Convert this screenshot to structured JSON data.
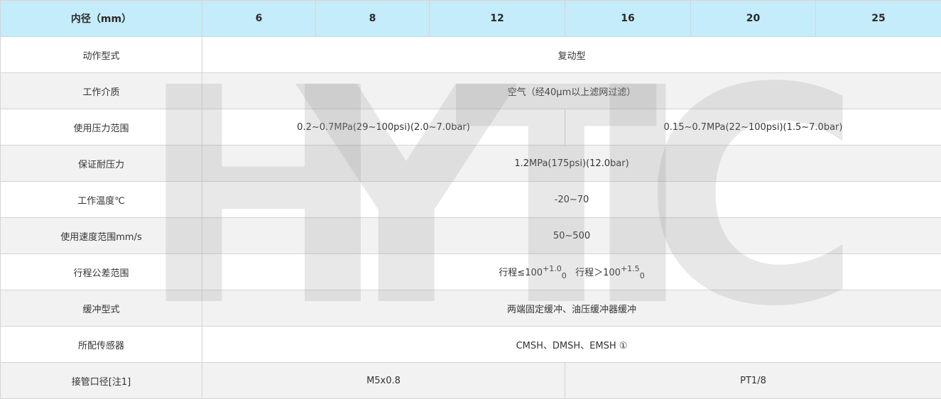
{
  "table": {
    "header": {
      "label": "内径（mm）",
      "sizes": [
        "6",
        "8",
        "12",
        "16",
        "20",
        "25"
      ]
    },
    "rows": {
      "action_type": {
        "label": "动作型式",
        "value": "复动型"
      },
      "medium": {
        "label": "工作介质",
        "value": "空气（经40μm以上滤网过滤）"
      },
      "pressure_range": {
        "label": "使用压力范围",
        "small": "0.2~0.7MPa(29~100psi)(2.0~7.0bar)",
        "large": "0.15~0.7MPa(22~100psi)(1.5~7.0bar)"
      },
      "proof_pressure": {
        "label": "保证耐压力",
        "value": "1.2MPa(175psi)(12.0bar)"
      },
      "temperature": {
        "label": "工作温度℃",
        "value": "-20~70"
      },
      "speed_range": {
        "label": "使用速度范围mm/s",
        "value": "50~500"
      },
      "stroke_tolerance": {
        "label": "行程公差范围",
        "part1_base": "行程≤100",
        "part1_sup": "+1.0",
        "part1_sub": "0",
        "part2_base": "行程＞100",
        "part2_sup": "+1.5",
        "part2_sub": "0"
      },
      "cushion": {
        "label": "缓冲型式",
        "value": "两端固定缓冲、油压缓冲器缓冲"
      },
      "sensors": {
        "label": "所配传感器",
        "value": "CMSH、DMSH、EMSH ①"
      },
      "port_size": {
        "label": "接管口径[注1]",
        "small": "M5x0.8",
        "large": "PT1/8"
      }
    }
  },
  "watermark": {
    "text": [
      "H",
      "Y",
      "T",
      "I",
      "C"
    ],
    "color": "#969696"
  },
  "colors": {
    "header_bg": "#c5ecfa",
    "alt_row_bg": "#f2f2f2",
    "border": "#d4d4d4"
  }
}
